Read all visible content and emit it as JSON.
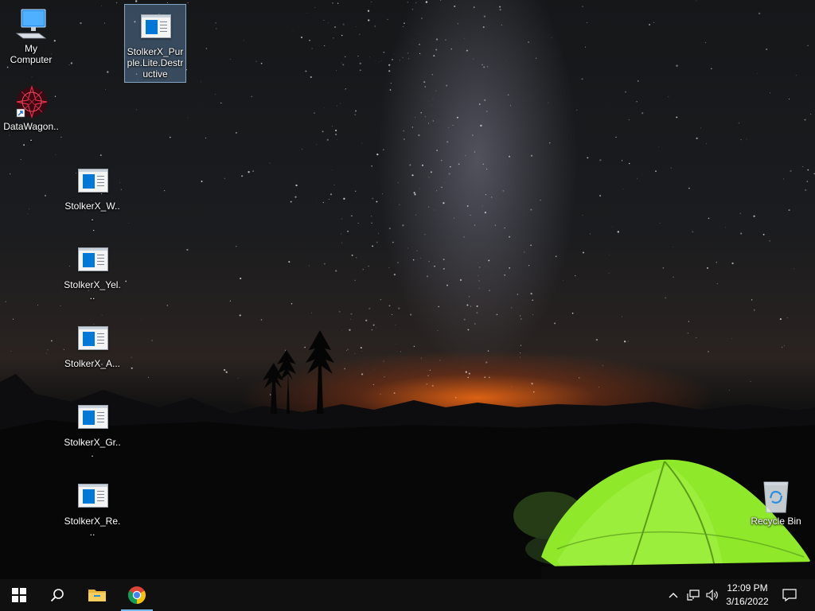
{
  "desktop": {
    "icons": [
      {
        "label": "My Computer",
        "icon": "computer-icon"
      },
      {
        "label": "DataWagon...",
        "icon": "datawagon-shortcut-icon"
      },
      {
        "label": "StolkerX_Purple.Lite.Destructive",
        "icon": "app-window-icon",
        "selected": true
      },
      {
        "label": "StolkerX_W...",
        "icon": "app-window-icon"
      },
      {
        "label": "StolkerX_Yel...",
        "icon": "app-window-icon"
      },
      {
        "label": "StolkerX_A...",
        "icon": "app-window-icon"
      },
      {
        "label": "StolkerX_Gr...",
        "icon": "app-window-icon"
      },
      {
        "label": "StolkerX_Re...",
        "icon": "app-window-icon"
      },
      {
        "label": "Recycle Bin",
        "icon": "recycle-bin-icon"
      }
    ]
  },
  "taskbar": {
    "start": "windows-start-icon",
    "search": "search-icon",
    "pinned": [
      "file-explorer-icon",
      "chrome-icon"
    ],
    "tray_icons": [
      "chevron-up-icon",
      "network-icon",
      "volume-icon"
    ],
    "clock": {
      "time": "12:09 PM",
      "date": "3/16/2022"
    },
    "notification": "notification-icon"
  },
  "colors": {
    "accent": "#0078d7",
    "taskbar": "#101010",
    "tent": "#8fe82a"
  }
}
